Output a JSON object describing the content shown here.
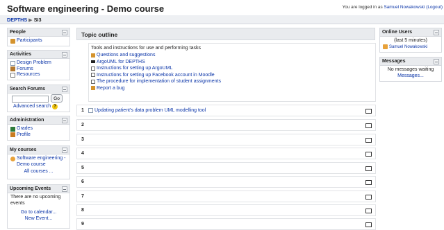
{
  "header": {
    "title": "Software engineering - Demo course",
    "login_prefix": "You are logged in as ",
    "login_user": "Samuel Nowakowski",
    "logout": "(Logout)"
  },
  "breadcrumb": {
    "home": "DEPTHS",
    "separator": "▶",
    "current": "SI3"
  },
  "left": {
    "people": {
      "title": "People",
      "participants": "Participants"
    },
    "activities": {
      "title": "Activities",
      "items": [
        "Design Problem",
        "Forums",
        "Resources"
      ]
    },
    "search": {
      "title": "Search Forums",
      "go": "Go",
      "advanced": "Advanced search"
    },
    "administration": {
      "title": "Administration",
      "items": [
        "Grades",
        "Profile"
      ]
    },
    "my_courses": {
      "title": "My courses",
      "course": "Software engineering - Demo course",
      "all": "All courses ..."
    },
    "upcoming": {
      "title": "Upcoming Events",
      "none": "There are no upcoming events",
      "calendar": "Go to calendar...",
      "new_event": "New Event..."
    }
  },
  "main": {
    "outline_title": "Topic outline",
    "topic0_summary": "Tools and instructions for use and performing tasks",
    "topic0_items": [
      "Questions and suggestions",
      "ArgoUML for DEPTHS",
      "Instructions for setting up ArgoUML",
      "Instructions for setting up Facebook account in Moodle",
      "The procedure for implementation of student assignments",
      "Report a bug"
    ],
    "sections": [
      {
        "num": "1",
        "content": "Updating patient's data problem UML modelling tool"
      },
      {
        "num": "2",
        "content": ""
      },
      {
        "num": "3",
        "content": ""
      },
      {
        "num": "4",
        "content": ""
      },
      {
        "num": "5",
        "content": ""
      },
      {
        "num": "6",
        "content": ""
      },
      {
        "num": "7",
        "content": ""
      },
      {
        "num": "8",
        "content": ""
      },
      {
        "num": "9",
        "content": ""
      }
    ]
  },
  "right": {
    "online": {
      "title": "Online Users",
      "period": "(last 5 minutes)",
      "user": "Samuel Nowakowski"
    },
    "messages": {
      "title": "Messages",
      "none": "No messages waiting",
      "link": "Messages..."
    }
  },
  "colors": {
    "link": "#0b35a8",
    "block_header": "#e9ebee",
    "border": "#d6d9de"
  }
}
